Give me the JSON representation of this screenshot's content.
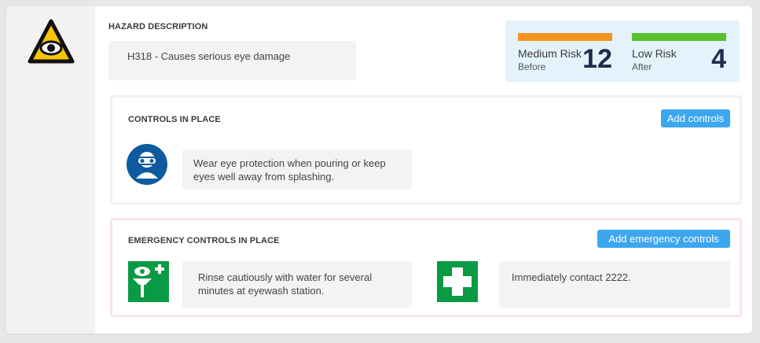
{
  "hazard": {
    "section_label": "HAZARD DESCRIPTION",
    "description": "H318 - Causes serious eye damage",
    "icon": "eye-hazard-icon"
  },
  "risk": {
    "before": {
      "label": "Medium Risk",
      "sub": "Before",
      "score": "12",
      "color": "#f7941d"
    },
    "after": {
      "label": "Low Risk",
      "sub": "After",
      "score": "4",
      "color": "#58c02e"
    }
  },
  "controls": {
    "section_label": "CONTROLS IN PLACE",
    "add_label": "Add controls",
    "items": [
      {
        "icon": "eye-protection-icon",
        "text": "Wear eye protection when pouring or keep eyes well away from splashing."
      }
    ]
  },
  "emergency": {
    "section_label": "EMERGENCY CONTROLS IN PLACE",
    "add_label": "Add emergency controls",
    "items": [
      {
        "icon": "eyewash-station-icon",
        "text": "Rinse cautiously with water for several minutes at eyewash station."
      },
      {
        "icon": "first-aid-icon",
        "text": "Immediately contact 2222."
      }
    ]
  },
  "colors": {
    "accent": "#3ca7ee",
    "safety_blue": "#0d5b9e",
    "safety_green": "#0a9a44",
    "hazard_yellow": "#f6c400"
  }
}
